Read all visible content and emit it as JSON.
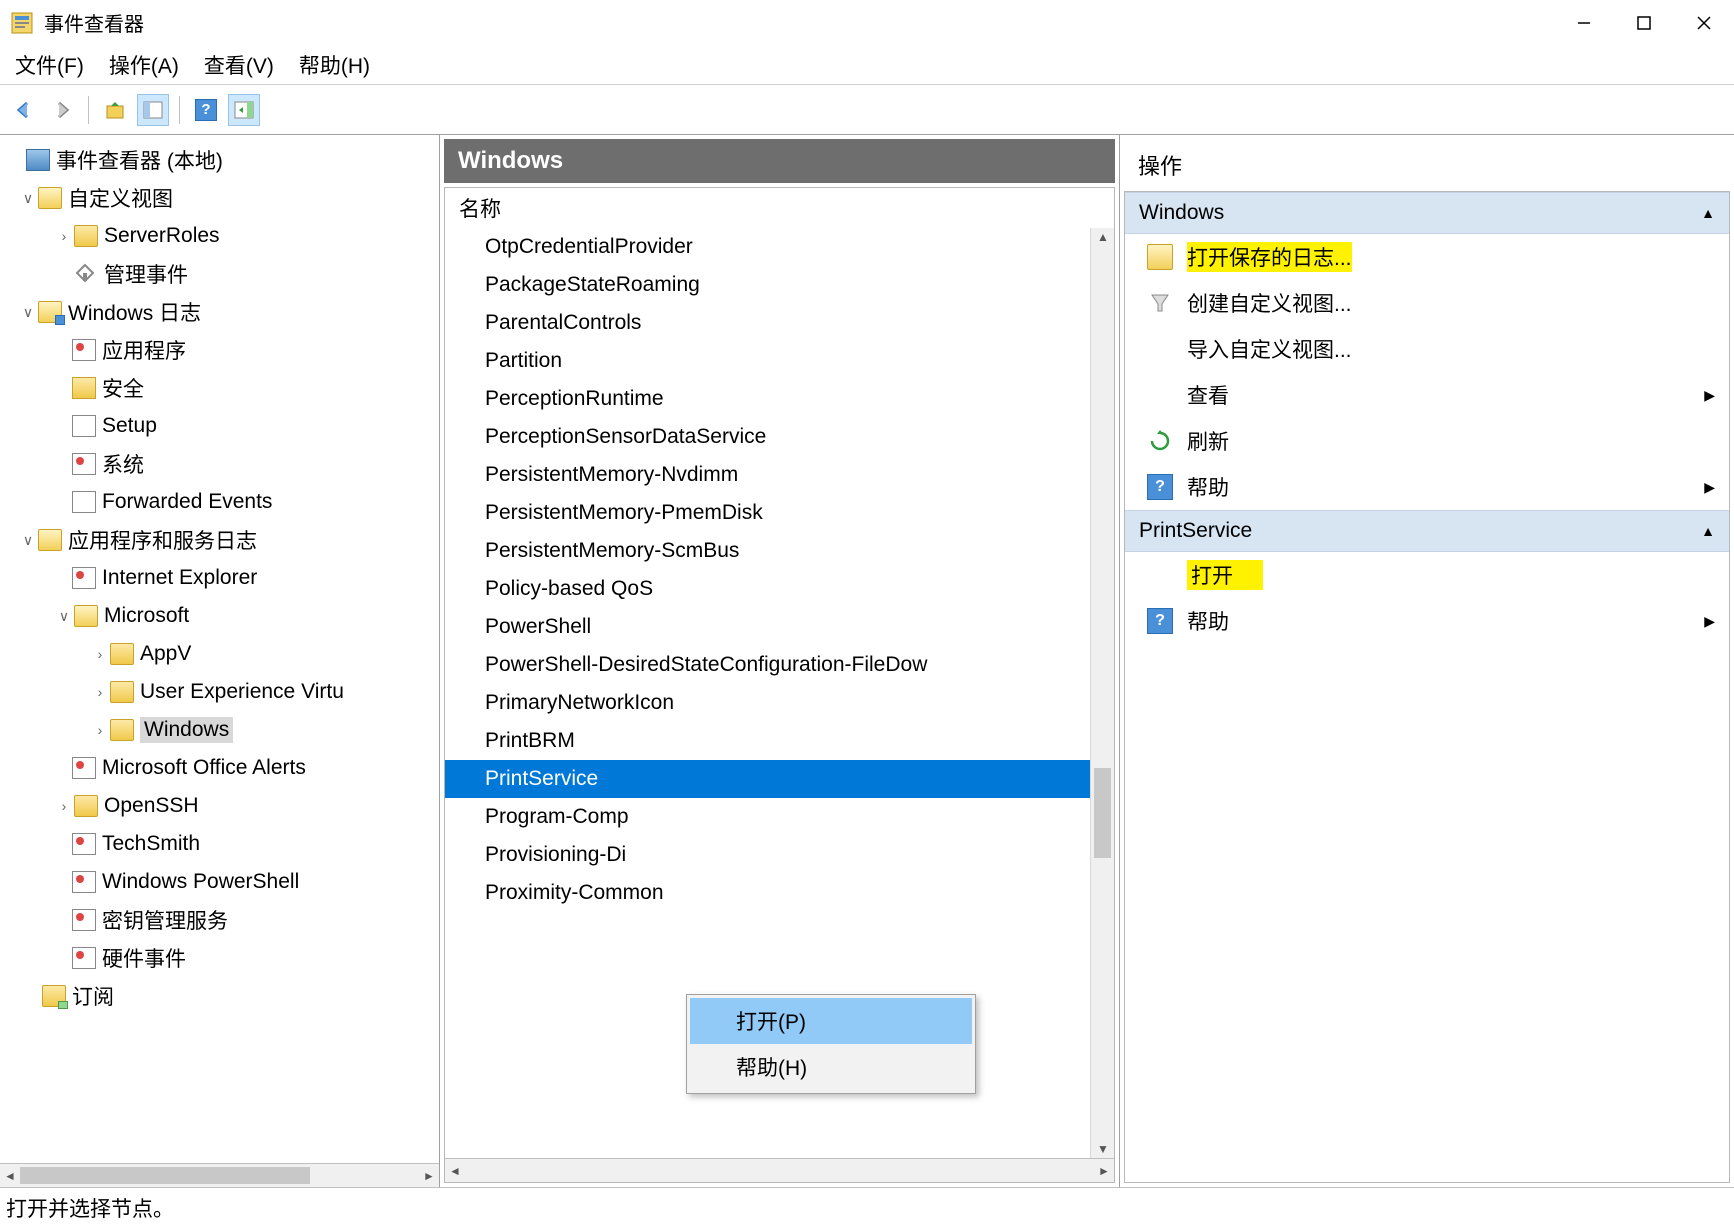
{
  "window": {
    "title": "事件查看器"
  },
  "menubar": [
    "文件(F)",
    "操作(A)",
    "查看(V)",
    "帮助(H)"
  ],
  "tree": {
    "root": "事件查看器 (本地)",
    "n1": "自定义视图",
    "n1a": "ServerRoles",
    "n1b": "管理事件",
    "n2": "Windows 日志",
    "n2a": "应用程序",
    "n2b": "安全",
    "n2c": "Setup",
    "n2d": "系统",
    "n2e": "Forwarded Events",
    "n3": "应用程序和服务日志",
    "n3a": "Internet Explorer",
    "n3b": "Microsoft",
    "n3b1": "AppV",
    "n3b2": "User Experience Virtu",
    "n3b3": "Windows",
    "n3c": "Microsoft Office Alerts",
    "n3d": "OpenSSH",
    "n3e": "TechSmith",
    "n3f": "Windows PowerShell",
    "n3g": "密钥管理服务",
    "n3h": "硬件事件",
    "n4": "订阅"
  },
  "mid": {
    "header": "Windows",
    "col": "名称",
    "items": [
      "OtpCredentialProvider",
      "PackageStateRoaming",
      "ParentalControls",
      "Partition",
      "PerceptionRuntime",
      "PerceptionSensorDataService",
      "PersistentMemory-Nvdimm",
      "PersistentMemory-PmemDisk",
      "PersistentMemory-ScmBus",
      "Policy-based QoS",
      "PowerShell",
      "PowerShell-DesiredStateConfiguration-FileDow",
      "PrimaryNetworkIcon",
      "PrintBRM",
      "PrintService",
      "Program-Comp",
      "Provisioning-Di",
      "Proximity-Common"
    ],
    "selected_index": 14
  },
  "context_menu": {
    "open": "打开(P)",
    "help": "帮助(H)"
  },
  "actions": {
    "title": "操作",
    "section1": "Windows",
    "a1": "打开保存的日志...",
    "a2": "创建自定义视图...",
    "a3": "导入自定义视图...",
    "a4": "查看",
    "a5": "刷新",
    "a6": "帮助",
    "section2": "PrintService",
    "b1": "打开",
    "b2": "帮助"
  },
  "statusbar": "打开并选择节点。"
}
